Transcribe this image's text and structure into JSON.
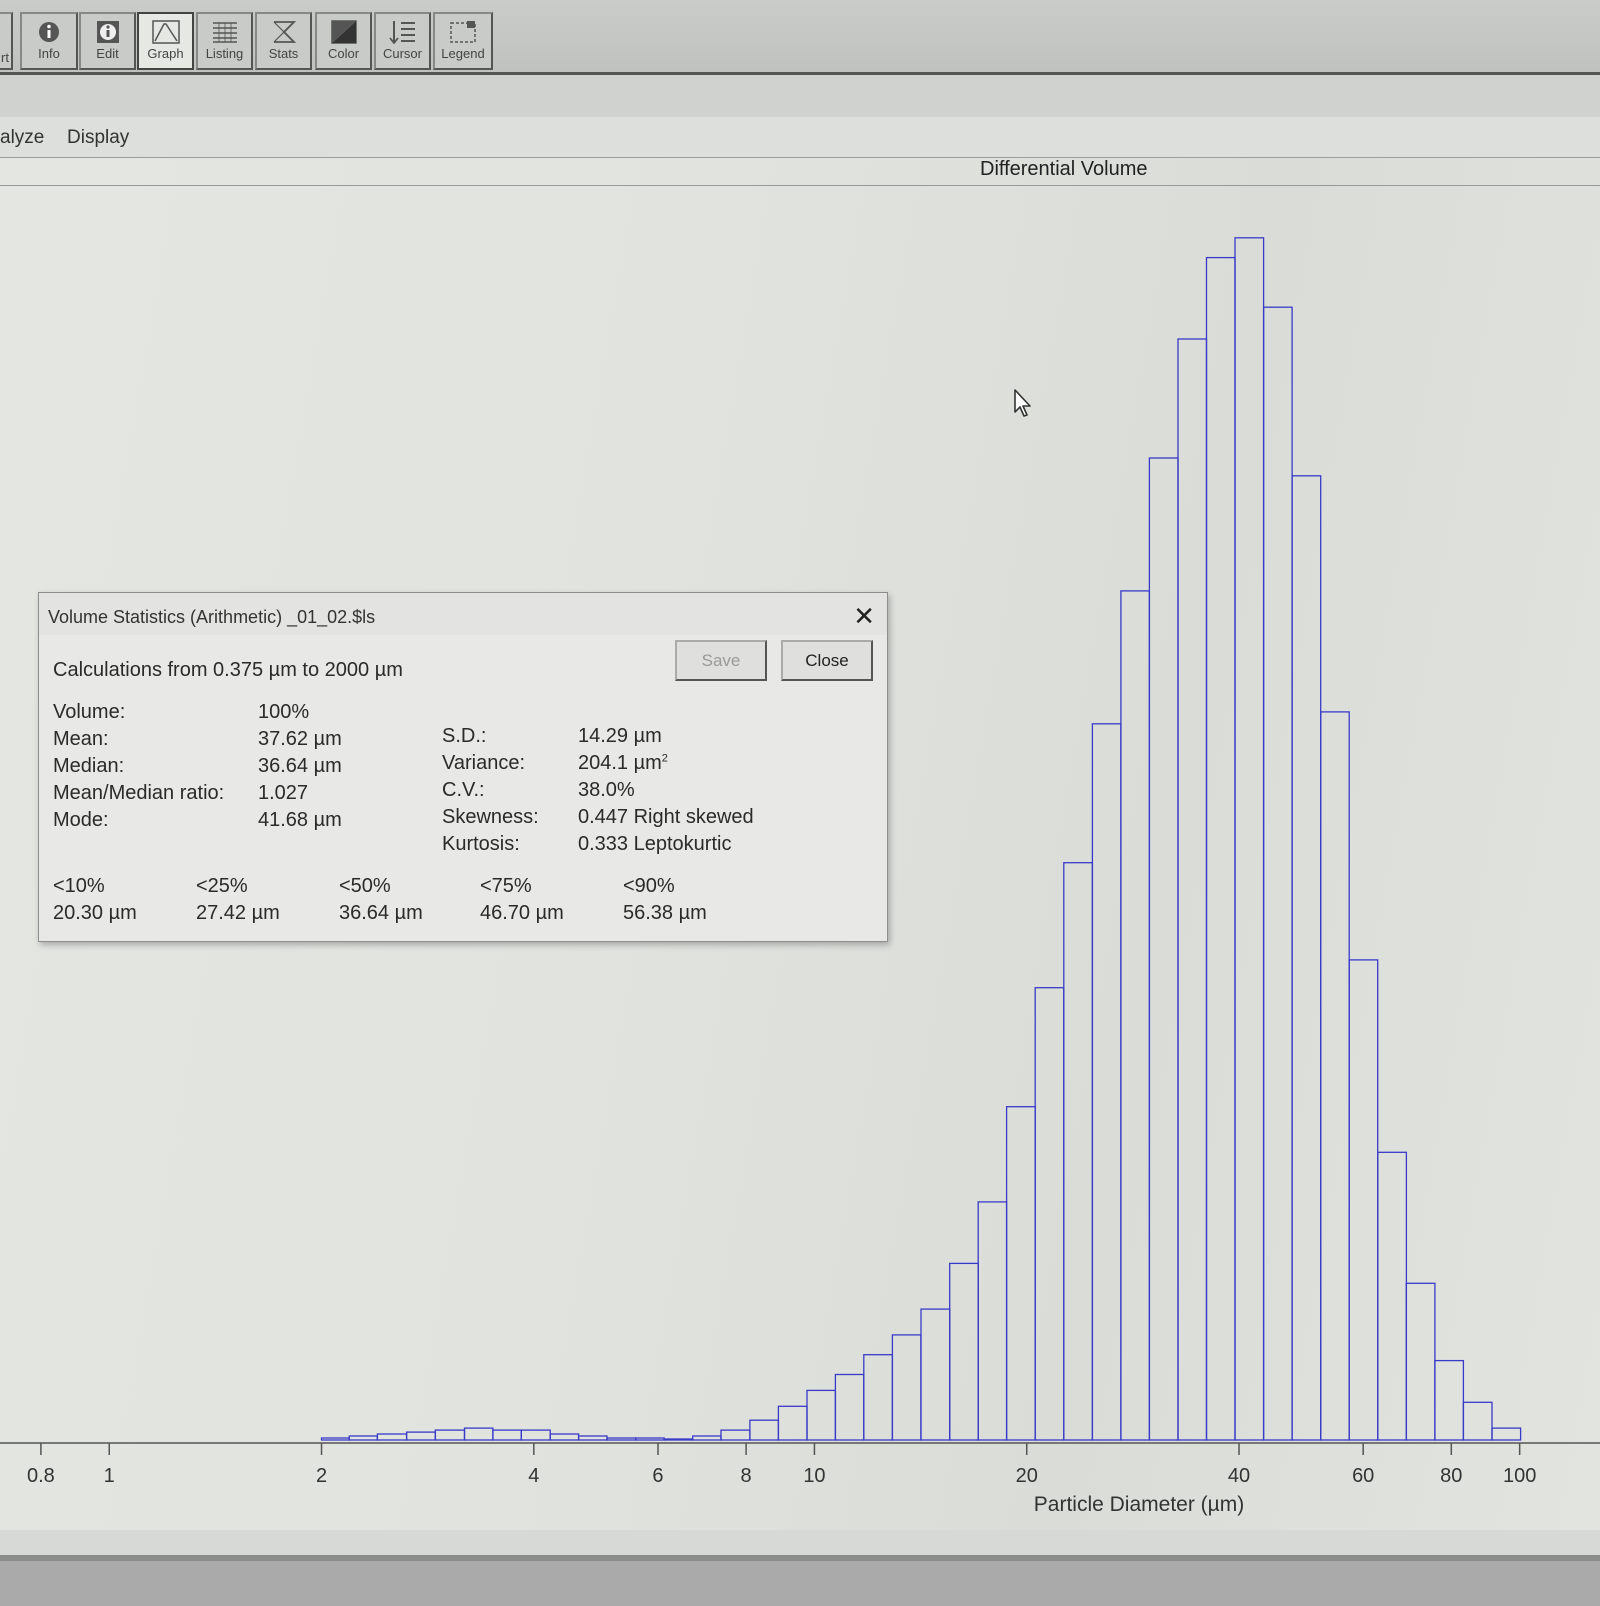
{
  "toolbar": {
    "partial_label": "rt",
    "buttons": [
      {
        "label": "Info",
        "icon": "info-icon"
      },
      {
        "label": "Edit",
        "icon": "edit-info-icon"
      },
      {
        "label": "Graph",
        "icon": "graph-icon",
        "active": true
      },
      {
        "label": "Listing",
        "icon": "listing-icon"
      },
      {
        "label": "Stats",
        "icon": "stats-icon"
      },
      {
        "label": "Color",
        "icon": "color-icon"
      },
      {
        "label": "Cursor",
        "icon": "cursor-list-icon"
      },
      {
        "label": "Legend",
        "icon": "legend-icon"
      }
    ]
  },
  "menu": {
    "items": [
      "alyze",
      "Display"
    ]
  },
  "chart": {
    "title": "Differential Volume"
  },
  "chart_data": {
    "type": "bar",
    "title": "Differential Volume",
    "xlabel": "Particle Diameter (µm)",
    "ylabel": "",
    "x_scale": "log",
    "x_ticks": [
      0.8,
      1,
      2,
      4,
      6,
      8,
      10,
      20,
      40,
      60,
      80,
      100
    ],
    "x_tick_labels": [
      "0.8",
      "1",
      "2",
      "4",
      "6",
      "8",
      "10",
      "20",
      "40",
      "60",
      "80",
      "100"
    ],
    "xlim": [
      0.7,
      130
    ],
    "ylim": [
      0,
      6.2
    ],
    "grid": false,
    "bar_color": "#3a3ac8",
    "bins": [
      {
        "x0": 2.0,
        "x1": 2.19,
        "value": 0.01
      },
      {
        "x0": 2.19,
        "x1": 2.4,
        "value": 0.02
      },
      {
        "x0": 2.4,
        "x1": 2.64,
        "value": 0.03
      },
      {
        "x0": 2.64,
        "x1": 2.9,
        "value": 0.04
      },
      {
        "x0": 2.9,
        "x1": 3.19,
        "value": 0.05
      },
      {
        "x0": 3.19,
        "x1": 3.5,
        "value": 0.06
      },
      {
        "x0": 3.5,
        "x1": 3.84,
        "value": 0.05
      },
      {
        "x0": 3.84,
        "x1": 4.22,
        "value": 0.05
      },
      {
        "x0": 4.22,
        "x1": 4.63,
        "value": 0.03
      },
      {
        "x0": 4.63,
        "x1": 5.08,
        "value": 0.02
      },
      {
        "x0": 5.08,
        "x1": 5.58,
        "value": 0.01
      },
      {
        "x0": 5.58,
        "x1": 6.12,
        "value": 0.01
      },
      {
        "x0": 6.12,
        "x1": 6.72,
        "value": 0.005
      },
      {
        "x0": 6.72,
        "x1": 7.37,
        "value": 0.02
      },
      {
        "x0": 7.37,
        "x1": 8.1,
        "value": 0.05
      },
      {
        "x0": 8.1,
        "x1": 8.89,
        "value": 0.1
      },
      {
        "x0": 8.89,
        "x1": 9.76,
        "value": 0.17
      },
      {
        "x0": 9.76,
        "x1": 10.71,
        "value": 0.25
      },
      {
        "x0": 10.71,
        "x1": 11.75,
        "value": 0.33
      },
      {
        "x0": 11.75,
        "x1": 12.9,
        "value": 0.43
      },
      {
        "x0": 12.9,
        "x1": 14.16,
        "value": 0.53
      },
      {
        "x0": 14.16,
        "x1": 15.55,
        "value": 0.66
      },
      {
        "x0": 15.55,
        "x1": 17.07,
        "value": 0.89
      },
      {
        "x0": 17.07,
        "x1": 18.73,
        "value": 1.2
      },
      {
        "x0": 18.73,
        "x1": 20.56,
        "value": 1.68
      },
      {
        "x0": 20.56,
        "x1": 22.57,
        "value": 2.28
      },
      {
        "x0": 22.57,
        "x1": 24.78,
        "value": 2.91
      },
      {
        "x0": 24.78,
        "x1": 27.2,
        "value": 3.61
      },
      {
        "x0": 27.2,
        "x1": 29.85,
        "value": 4.28
      },
      {
        "x0": 29.85,
        "x1": 32.77,
        "value": 4.95
      },
      {
        "x0": 32.77,
        "x1": 35.97,
        "value": 5.55
      },
      {
        "x0": 35.97,
        "x1": 39.48,
        "value": 5.96
      },
      {
        "x0": 39.48,
        "x1": 43.34,
        "value": 6.06
      },
      {
        "x0": 43.34,
        "x1": 47.57,
        "value": 5.71
      },
      {
        "x0": 47.57,
        "x1": 52.22,
        "value": 4.86
      },
      {
        "x0": 52.22,
        "x1": 57.32,
        "value": 3.67
      },
      {
        "x0": 57.32,
        "x1": 62.92,
        "value": 2.42
      },
      {
        "x0": 62.92,
        "x1": 69.07,
        "value": 1.45
      },
      {
        "x0": 69.07,
        "x1": 75.82,
        "value": 0.79
      },
      {
        "x0": 75.82,
        "x1": 83.22,
        "value": 0.4
      },
      {
        "x0": 83.22,
        "x1": 91.36,
        "value": 0.19
      },
      {
        "x0": 91.36,
        "x1": 100.3,
        "value": 0.06
      }
    ]
  },
  "dialog": {
    "title": "Volume Statistics (Arithmetic)  _01_02.$ls",
    "close_icon": "close-icon",
    "save_label": "Save",
    "close_label": "Close",
    "range_text": "Calculations from 0.375 µm to 2000 µm",
    "left_stats": [
      {
        "label": "Volume:",
        "value": "100%"
      },
      {
        "label": "Mean:",
        "value": "37.62 µm"
      },
      {
        "label": "Median:",
        "value": "36.64 µm"
      },
      {
        "label": "Mean/Median ratio:",
        "value": "1.027"
      },
      {
        "label": "Mode:",
        "value": "41.68 µm"
      }
    ],
    "right_stats": [
      {
        "label": "S.D.:",
        "value": "14.29 µm"
      },
      {
        "label": "Variance:",
        "value": "204.1 µm",
        "sup": "2"
      },
      {
        "label": "C.V.:",
        "value": "38.0%"
      },
      {
        "label": "Skewness:",
        "value": "0.447 Right skewed"
      },
      {
        "label": "Kurtosis:",
        "value": "0.333 Leptokurtic"
      }
    ],
    "percentiles": [
      {
        "label": "<10%",
        "value": "20.30 µm"
      },
      {
        "label": "<25%",
        "value": "27.42 µm"
      },
      {
        "label": "<50%",
        "value": "36.64 µm"
      },
      {
        "label": "<75%",
        "value": "46.70 µm"
      },
      {
        "label": "<90%",
        "value": "56.38 µm"
      }
    ]
  }
}
